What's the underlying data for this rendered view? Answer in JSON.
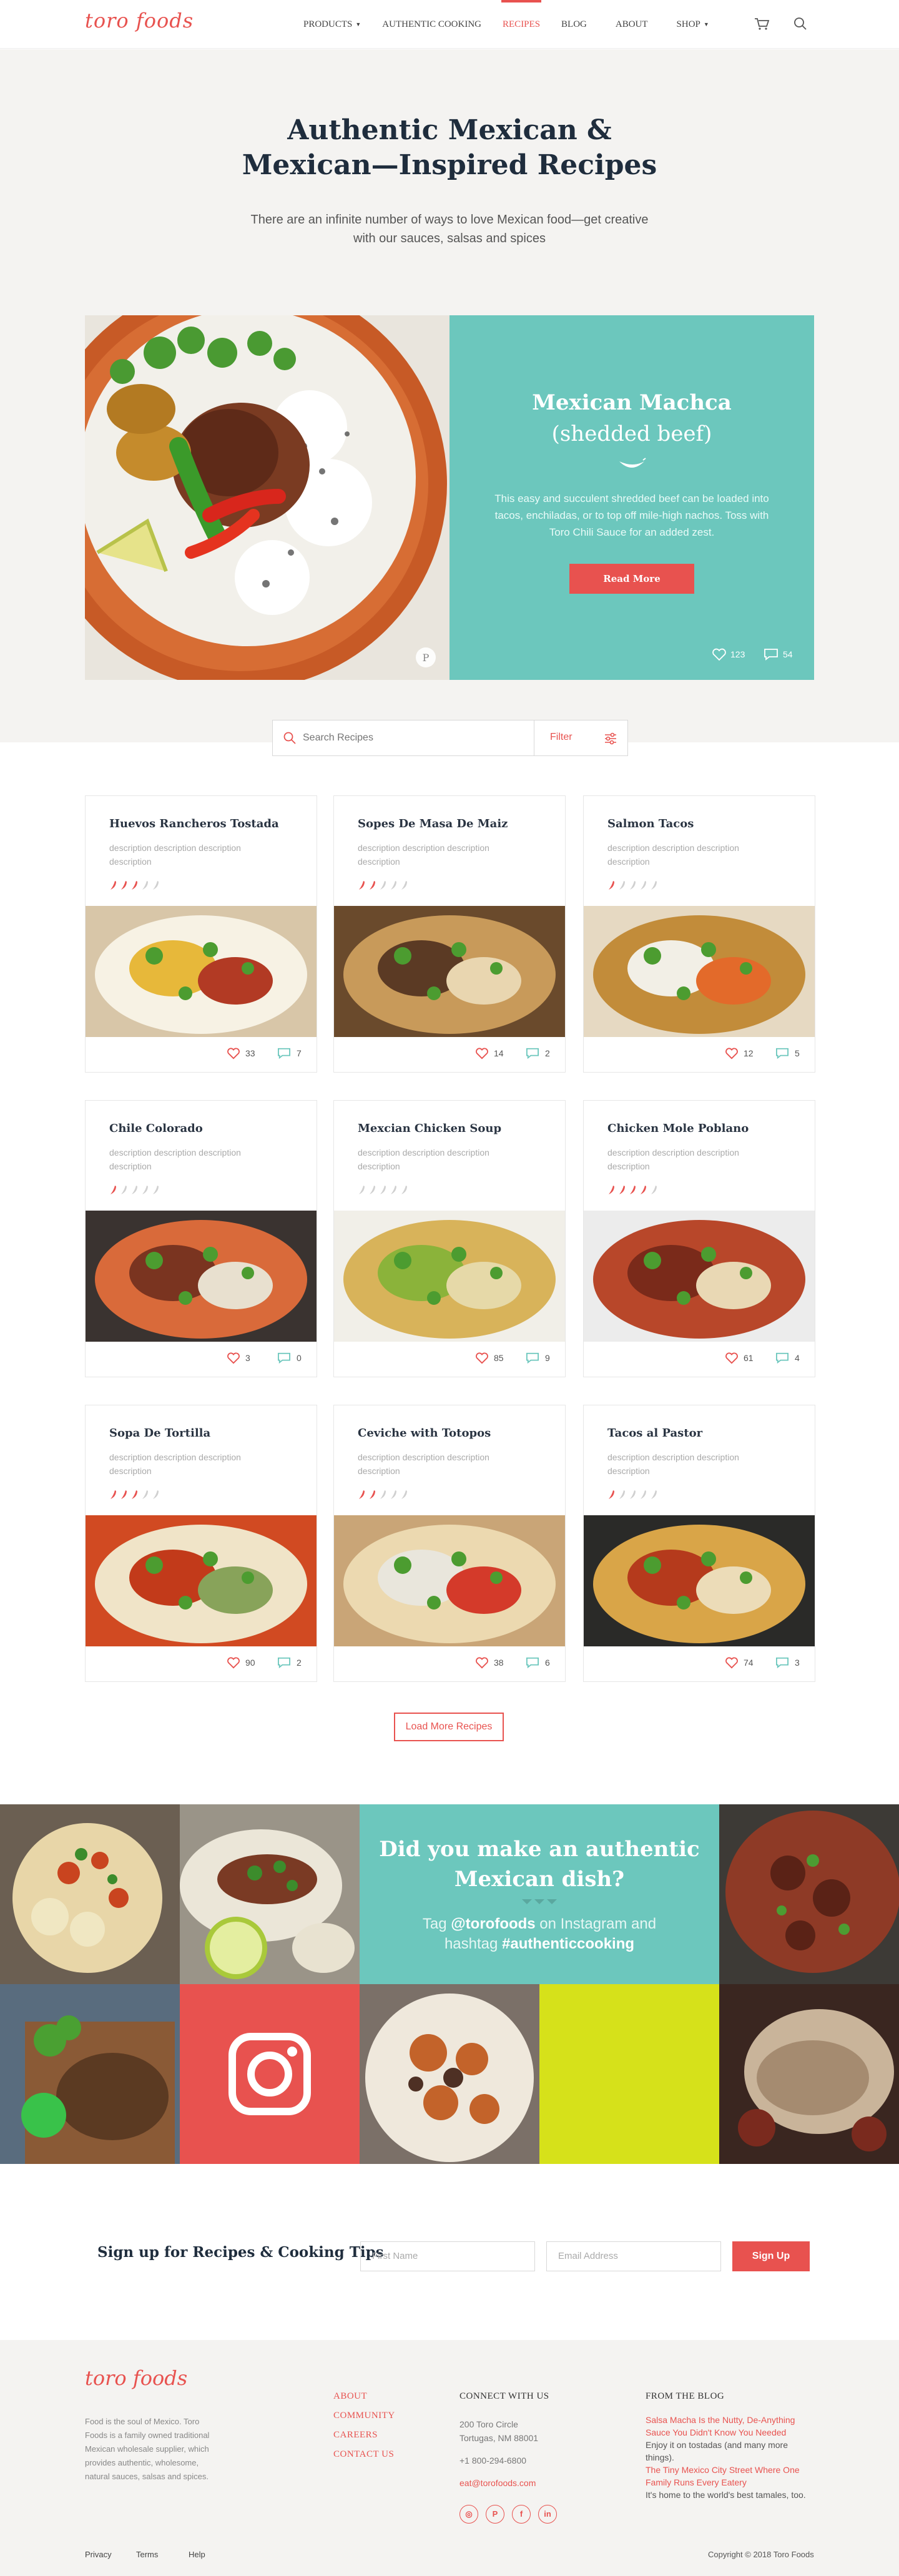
{
  "header": {
    "logo": "toro foods",
    "nav": [
      {
        "label": "PRODUCTS",
        "caret": true
      },
      {
        "label": "AUTHENTIC COOKING",
        "caret": false
      },
      {
        "label": "RECIPES",
        "caret": false,
        "active": true
      },
      {
        "label": "BLOG",
        "caret": false
      },
      {
        "label": "ABOUT",
        "caret": false
      },
      {
        "label": "SHOP",
        "caret": true
      }
    ],
    "icons": [
      "cart-icon",
      "search-icon"
    ]
  },
  "hero": {
    "title_line1": "Authentic Mexican &",
    "title_line2": "Mexican—Inspired Recipes",
    "subtitle_line1": "There are an infinite number of ways to love Mexican food—get creative",
    "subtitle_line2": "with our sauces, salsas and spices"
  },
  "featured": {
    "title": "Mexican Machca",
    "subtitle": "(shedded beef)",
    "description": "This easy and succulent shredded beef can be loaded into tacos, enchiladas, or to top off mile-high nachos. Toss with Toro Chili Sauce for an added zest.",
    "button": "Read More",
    "likes": "123",
    "comments": "54"
  },
  "search": {
    "placeholder": "Search Recipes",
    "filter_label": "Filter"
  },
  "recipes": [
    {
      "title": "Huevos Rancheros Tostada",
      "description": "description description description description",
      "spice": 3,
      "likes": "33",
      "comments": "7"
    },
    {
      "title": "Sopes De Masa De Maiz",
      "description": "description description description description",
      "spice": 2,
      "likes": "14",
      "comments": "2"
    },
    {
      "title": "Salmon Tacos",
      "description": "description description description description",
      "spice": 1,
      "likes": "12",
      "comments": "5"
    },
    {
      "title": "Chile Colorado",
      "description": "description description description description",
      "spice": 1,
      "likes": "3",
      "comments": "0"
    },
    {
      "title": "Mexcian Chicken Soup",
      "description": "description description description description",
      "spice": 0,
      "likes": "85",
      "comments": "9"
    },
    {
      "title": "Chicken Mole Poblano",
      "description": "description description description description",
      "spice": 4,
      "likes": "61",
      "comments": "4"
    },
    {
      "title": "Sopa De Tortilla",
      "description": "description description description description",
      "spice": 3,
      "likes": "90",
      "comments": "2"
    },
    {
      "title": "Ceviche with Totopos",
      "description": "description description description description",
      "spice": 2,
      "likes": "38",
      "comments": "6"
    },
    {
      "title": "Tacos al Pastor",
      "description": "description description description description",
      "spice": 1,
      "likes": "74",
      "comments": "3"
    }
  ],
  "load_more": "Load More Recipes",
  "instagram": {
    "question_line1": "Did you make an authentic",
    "question_line2": "Mexican dish?",
    "tag_prefix": "Tag ",
    "handle": "@torofoods",
    "tag_mid": " on Instagram and",
    "tag_prefix2": "hashtag ",
    "hashtag": "#authenticcooking"
  },
  "signup": {
    "label": "Sign up for Recipes & Cooking Tips",
    "first_name_placeholder": "First Name",
    "email_placeholder": "Email Address",
    "button": "Sign Up"
  },
  "footer": {
    "logo": "toro foods",
    "about": "Food is the soul of Mexico. Toro Foods is a family owned traditional Mexican wholesale supplier, which provides authentic, wholesome, natural sauces, salsas and spices.",
    "nav": [
      "ABOUT",
      "COMMUNITY",
      "CAREERS",
      "CONTACT US"
    ],
    "connect_heading": "CONNECT WITH US",
    "address_line1": "200 Toro Circle",
    "address_line2": "Tortugas, NM 88001",
    "phone": "+1 800-294-6800",
    "email": "eat@torofoods.com",
    "social": [
      "instagram-icon",
      "pinterest-icon",
      "facebook-icon",
      "linkedin-icon"
    ],
    "blog_heading": "FROM THE BLOG",
    "blog": [
      {
        "title": "Salsa Macha Is the Nutty, De-Anything Sauce You Didn't Know You Needed",
        "snippet": "Enjoy it on tostadas (and many more things)."
      },
      {
        "title": "The Tiny Mexico City Street Where One Family Runs Every Eatery",
        "snippet": "It's home to the world's best tamales, too."
      }
    ],
    "links": [
      "Privacy",
      "Terms",
      "Help"
    ],
    "copyright": "Copyright © 2018 Toro Foods"
  },
  "colors": {
    "accent": "#e8524f",
    "teal": "#6cc7bd",
    "lime": "#d6e11a"
  }
}
